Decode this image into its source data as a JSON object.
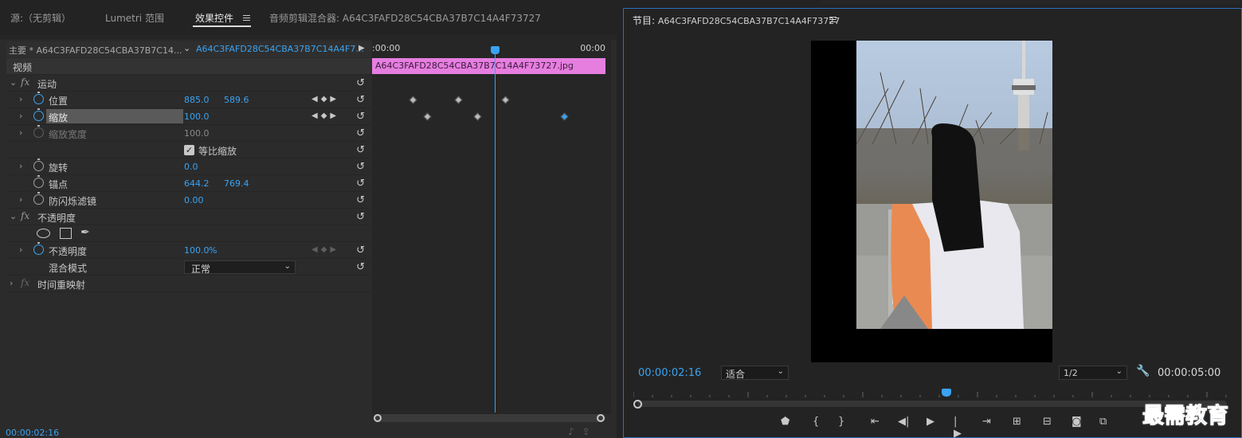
{
  "left_tabs": [
    {
      "label": "源:（无剪辑）"
    },
    {
      "label": "Lumetri 范围"
    },
    {
      "label": "效果控件"
    },
    {
      "label": "音频剪辑混合器: A64C3FAFD28C54CBA37B7C14A4F73727"
    }
  ],
  "clip_header": {
    "master": "主要 * A64C3FAFD28C54CBA37B7C14...",
    "clip": "A64C3FAFD28C54CBA37B7C14A4F7..."
  },
  "section_video": "视频",
  "motion": {
    "label": "运动",
    "position": {
      "label": "位置",
      "x": "885.0",
      "y": "589.6"
    },
    "scale": {
      "label": "缩放",
      "value": "100.0"
    },
    "scale_width": {
      "label": "缩放宽度",
      "value": "100.0"
    },
    "uniform_scale": {
      "label": "等比缩放"
    },
    "rotation": {
      "label": "旋转",
      "value": "0.0"
    },
    "anchor": {
      "label": "锚点",
      "x": "644.2",
      "y": "769.4"
    },
    "antiflicker": {
      "label": "防闪烁滤镜",
      "value": "0.00"
    }
  },
  "opacity": {
    "label": "不透明度",
    "opacity": {
      "label": "不透明度",
      "value": "100.0",
      "unit": "%"
    },
    "blend": {
      "label": "混合模式",
      "value": "正常"
    }
  },
  "time_remap": {
    "label": "时间重映射"
  },
  "timeline": {
    "start_tc": ":00:00",
    "end_tc": "00:00",
    "clip_name": "A64C3FAFD28C54CBA37B7C14A4F73727.jpg"
  },
  "left_timecode": "00:00:02:16",
  "program": {
    "title": "节目:",
    "sequence": "A64C3FAFD28C54CBA37B7C14A4F73727",
    "current_time": "00:00:02:16",
    "fit": "适合",
    "resolution": "1/2",
    "duration": "00:00:05:00"
  },
  "watermark": "最需教育",
  "colors": {
    "accent": "#3aa3f2",
    "clip": "#e67ee0",
    "watermark": "#2f58c8"
  }
}
